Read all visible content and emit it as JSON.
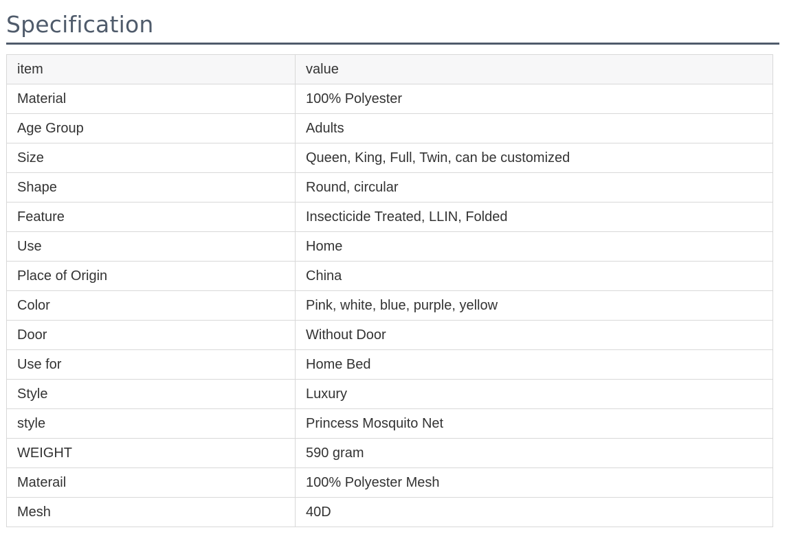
{
  "section": {
    "title": "Specification"
  },
  "table": {
    "header": {
      "item": "item",
      "value": "value"
    },
    "rows": [
      {
        "item": "Material",
        "value": "100% Polyester"
      },
      {
        "item": "Age Group",
        "value": "Adults"
      },
      {
        "item": "Size",
        "value": "Queen, King, Full, Twin, can be customized"
      },
      {
        "item": "Shape",
        "value": "Round, circular"
      },
      {
        "item": "Feature",
        "value": "Insecticide Treated, LLIN, Folded"
      },
      {
        "item": "Use",
        "value": "Home"
      },
      {
        "item": "Place of Origin",
        "value": "China"
      },
      {
        "item": "Color",
        "value": "Pink, white, blue, purple, yellow"
      },
      {
        "item": "Door",
        "value": "Without Door"
      },
      {
        "item": "Use for",
        "value": "Home Bed"
      },
      {
        "item": "Style",
        "value": "Luxury"
      },
      {
        "item": "style",
        "value": "Princess Mosquito Net"
      },
      {
        "item": "WEIGHT",
        "value": "590 gram"
      },
      {
        "item": "Materail",
        "value": "100% Polyester Mesh"
      },
      {
        "item": "Mesh",
        "value": "40D"
      }
    ]
  },
  "colors": {
    "title": "#4f5b6b",
    "border": "#d8d8d8",
    "header_bg": "#f7f7f8",
    "text": "#333333"
  }
}
